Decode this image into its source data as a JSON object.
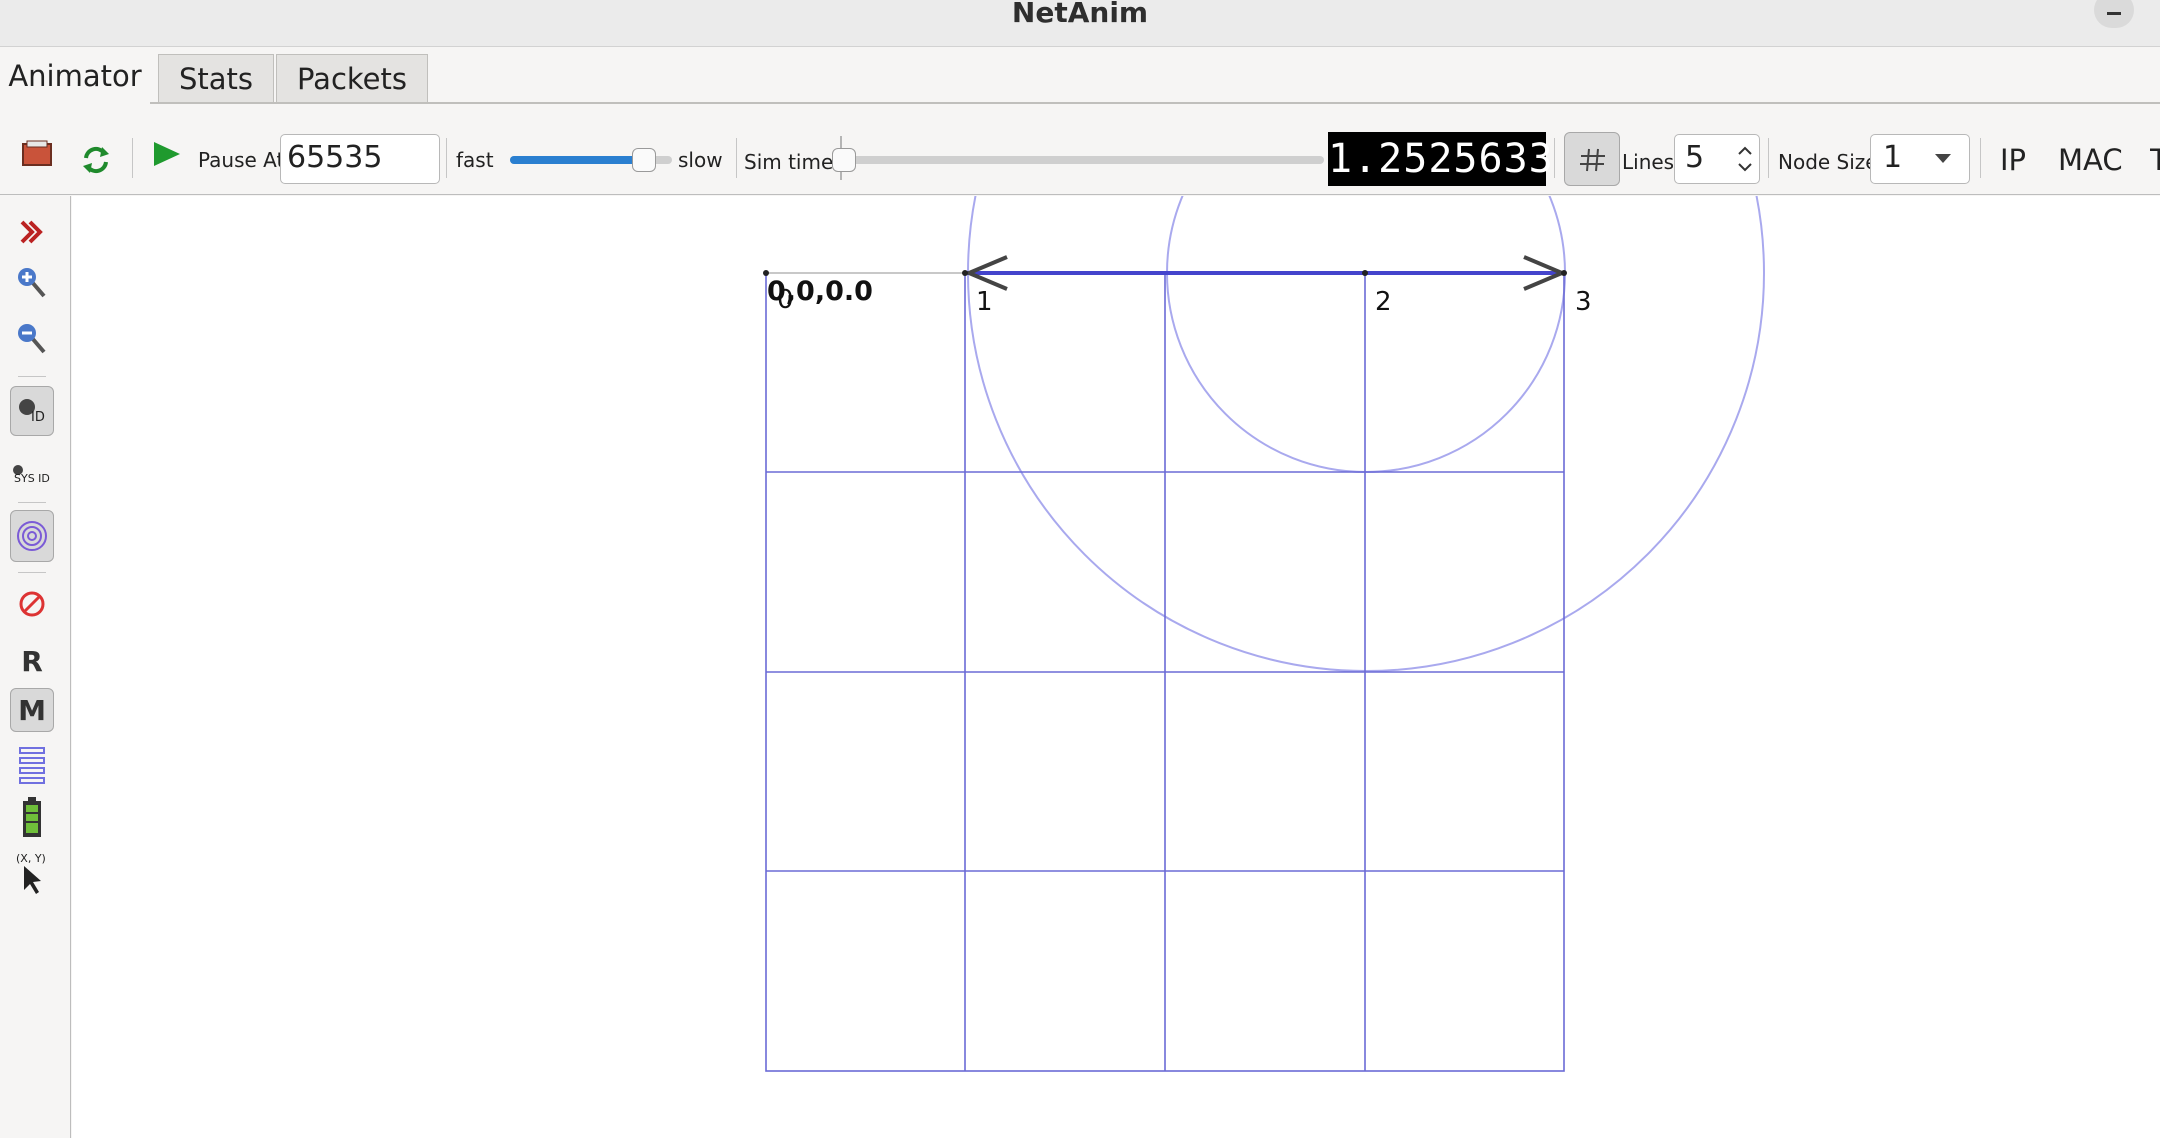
{
  "window": {
    "title": "NetAnim"
  },
  "tabs": [
    {
      "label": "Animator",
      "active": true
    },
    {
      "label": "Stats",
      "active": false
    },
    {
      "label": "Packets",
      "active": false
    }
  ],
  "toolbar": {
    "pause_at_label": "Pause At",
    "pause_at_value": "65535",
    "speed_fast_label": "fast",
    "speed_slow_label": "slow",
    "speed_level_fraction": 0.83,
    "sim_time_label": "Sim time",
    "sim_time_fraction": 0.0,
    "lcd_value": "1.2525633",
    "lines_label": "Lines",
    "lines_value": "5",
    "node_size_label": "Node Size",
    "node_size_value": "1",
    "ip_label": "IP",
    "mac_label": "MAC"
  },
  "left_toolbar": {
    "r_label": "R",
    "m_label": "M",
    "sys_id_label": "SYS ID",
    "id_label": "ID",
    "xy_label": "(X, Y)"
  },
  "canvas": {
    "origin_label": "0,0,0.0",
    "nodes": [
      {
        "id": "0"
      },
      {
        "id": "1"
      },
      {
        "id": "2"
      },
      {
        "id": "3"
      }
    ],
    "colors": {
      "grid": "#6b6bd6",
      "range_circle": "#a9a9ee",
      "link": "#4444cc",
      "arrow": "#444444"
    }
  }
}
